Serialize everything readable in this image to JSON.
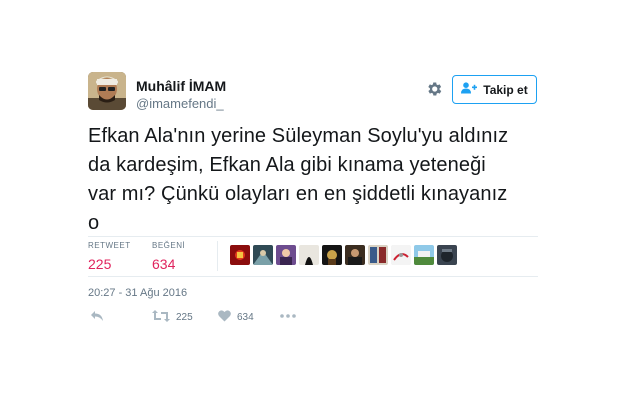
{
  "user": {
    "display_name": "Muhâlif İMAM",
    "handle": "@imamefendi_"
  },
  "header": {
    "follow_label": "Takip et"
  },
  "tweet": {
    "lines": [
      "Efkan Ala'nın yerine Süleyman Soylu'yu aldınız",
      "da kardeşim, Efkan Ala gibi kınama yeteneği",
      "var mı? Çünkü olayları en en şiddetli kınayanız",
      "o"
    ],
    "timestamp": "20:27 - 31 Ağu 2016"
  },
  "stats": {
    "retweet_label": "RETWEET",
    "retweet_count": "225",
    "like_label": "BEĞENİ",
    "like_count": "634"
  },
  "actions": {
    "retweet_count": "225",
    "like_count": "634"
  },
  "colors": {
    "accent": "#1da1f2",
    "stat_value": "#e0245e",
    "muted": "#657786"
  },
  "icons": [
    "gear-icon",
    "follow-person-icon",
    "reply-icon",
    "retweet-icon",
    "like-heart-icon",
    "more-icon"
  ]
}
